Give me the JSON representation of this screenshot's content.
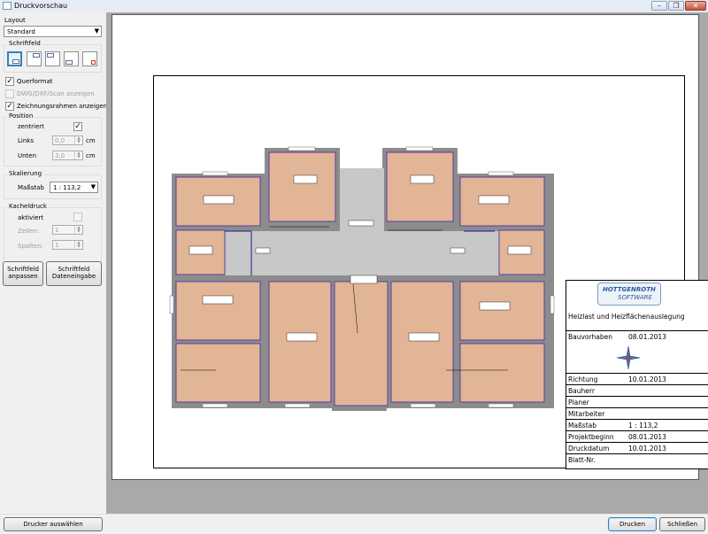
{
  "window": {
    "title": "Druckvorschau"
  },
  "layout": {
    "label": "Layout",
    "value": "Standard"
  },
  "schriftfeld": {
    "label": "Schriftfeld"
  },
  "options": [
    {
      "label": "Querformat",
      "checked": true,
      "enabled": true
    },
    {
      "label": "DWG/DXF/Scan anzeigen",
      "checked": false,
      "enabled": false
    },
    {
      "label": "Zeichnungsrahmen anzeigen",
      "checked": true,
      "enabled": true
    }
  ],
  "position": {
    "label": "Position",
    "zentriert": "zentriert",
    "links_label": "Links",
    "links_value": "0,0",
    "links_unit": "cm",
    "unten_label": "Unten",
    "unten_value": "3,0",
    "unten_unit": "cm"
  },
  "skalierung": {
    "label": "Skalierung",
    "massstab_label": "Maßstab",
    "massstab_value": "1 : 113,2"
  },
  "kacheldruck": {
    "label": "Kacheldruck",
    "aktiviert": "aktiviert",
    "zeilen_label": "Zeilen:",
    "zeilen_value": "1",
    "spalten_label": "Spalten:",
    "spalten_value": "1"
  },
  "buttons": {
    "schriftfeld_anpassen": "Schriftfeld anpassen",
    "schriftfeld_dateneingabe": "Schriftfeld Dateneingabe",
    "drucker_auswaehlen": "Drucker auswählen",
    "drucken": "Drucken",
    "schliessen": "Schließen"
  },
  "title_block": {
    "logo_line1": "HOTTGENROTH",
    "logo_line2": "SOFTWARE",
    "title": "Heizlast und Heizflächenauslegung",
    "rows": [
      {
        "key": "Bauvorhaben",
        "value": "08.01.2013"
      },
      {
        "key": "Richtung",
        "value": "10.01.2013"
      },
      {
        "key": "Bauherr",
        "value": ""
      },
      {
        "key": "Planer",
        "value": ""
      },
      {
        "key": "Mitarbeiter",
        "value": ""
      },
      {
        "key": "Maßstab",
        "value": "1 : 113,2"
      },
      {
        "key": "Projektbeginn",
        "value": "08.01.2013"
      },
      {
        "key": "Druckdatum",
        "value": "10.01.2013"
      },
      {
        "key": "Blatt-Nr.",
        "value": ""
      }
    ]
  },
  "colors": {
    "room_fill": "#e2b596",
    "wall": "#8c8c8c",
    "corridor": "#c8c8c8",
    "accent": "#3c7fb1"
  }
}
